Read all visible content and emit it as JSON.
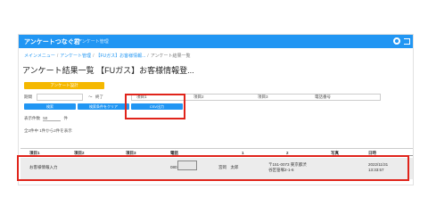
{
  "header": {
    "app_title": "アンケートつなぐ君",
    "app_subtitle": "アンケート管理"
  },
  "breadcrumb": {
    "items": [
      "メインメニュー",
      "アンケート管理",
      "【FUガス】お客様情報..."
    ],
    "current": "アンケート結果一覧"
  },
  "page": {
    "title": "アンケート結果一覧 【FUガス】お客様情報登..."
  },
  "buttons": {
    "survey_settings": "アンケート設計",
    "search": "検索",
    "clear": "検索条件をクリア",
    "csv_output": "CSV出力"
  },
  "filters": {
    "date_label": "期間",
    "date_placeholder": "",
    "separator": "〜",
    "end_label": "終了",
    "item_labels": [
      "項目1",
      "項目2",
      "項目3",
      "電話番号"
    ]
  },
  "pagination": {
    "per_page_label": "表示件数",
    "per_page_value": "50",
    "per_page_unit": "件",
    "range_text": "全2件中 1件から2件を表示"
  },
  "table": {
    "columns": [
      "項目1",
      "項目2",
      "項目3",
      "電話",
      "1",
      "2",
      "写真",
      "日時"
    ],
    "rows": [
      {
        "col1": "お客様情報入力",
        "col2": "",
        "col3": "",
        "phone_prefix": "080",
        "name": "宮岡　太郎",
        "address_line1": "〒151-0073 東京都渋",
        "address_line2": "谷区笹塚2-1-6",
        "photo": "",
        "date": "2022/11/31",
        "time": "13:33:57"
      }
    ]
  },
  "colors": {
    "primary": "#2196f3",
    "accent": "#f5b800",
    "highlight": "#e0241b"
  },
  "icons": {
    "settings": "gear-icon",
    "logout": "logout-icon"
  }
}
